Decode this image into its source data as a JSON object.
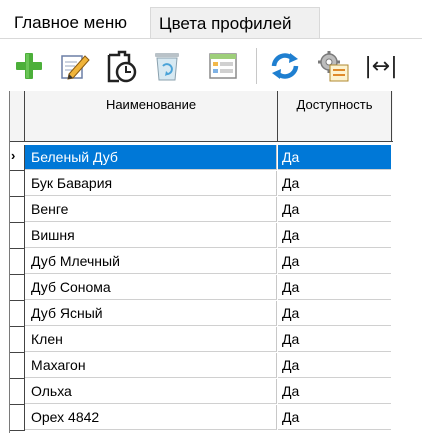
{
  "tabs": [
    {
      "label": "Главное меню"
    },
    {
      "label": "Цвета профилей"
    }
  ],
  "toolbar": {
    "icons": [
      "add-icon",
      "edit-icon",
      "history-icon",
      "recycle-bin-icon",
      "table-icon",
      "refresh-icon",
      "settings-icon",
      "fit-width-icon"
    ],
    "fit_width_label": "|↔|"
  },
  "grid": {
    "columns": [
      "Наименование",
      "Доступность"
    ],
    "rows": [
      {
        "name": "Беленый Дуб",
        "available": "Да",
        "selected": true
      },
      {
        "name": "Бук Бавария",
        "available": "Да"
      },
      {
        "name": "Венге",
        "available": "Да"
      },
      {
        "name": "Вишня",
        "available": "Да"
      },
      {
        "name": "Дуб Млечный",
        "available": "Да"
      },
      {
        "name": "Дуб Сонома",
        "available": "Да"
      },
      {
        "name": "Дуб Ясный",
        "available": "Да"
      },
      {
        "name": "Клен",
        "available": "Да"
      },
      {
        "name": "Махагон",
        "available": "Да"
      },
      {
        "name": "Ольха",
        "available": "Да"
      },
      {
        "name": "Орех 4842",
        "available": "Да"
      }
    ],
    "current_row_marker": "›",
    "selection_color": "#0078d7"
  }
}
